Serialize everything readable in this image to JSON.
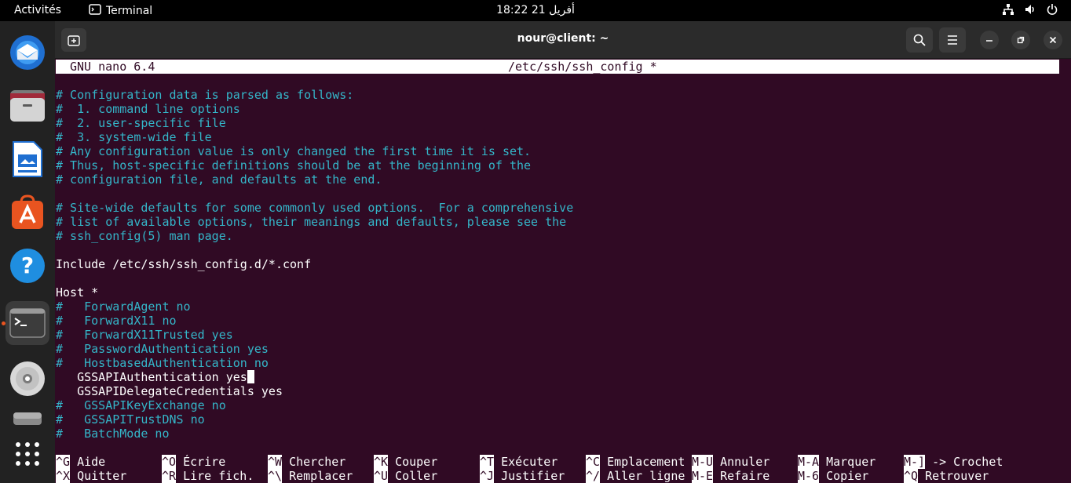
{
  "topbar": {
    "activities": "Activités",
    "app_name": "Terminal",
    "clock": "18:22  21 أفريل"
  },
  "dock": {
    "items": [
      "thunderbird-icon",
      "files-icon",
      "libreoffice-writer-icon",
      "app-center-icon",
      "help-icon",
      "terminal-icon",
      "disc-icon",
      "drive-icon",
      "app-grid-icon"
    ]
  },
  "window": {
    "title": "nour@client: ~"
  },
  "nano": {
    "version": "GNU nano 6.4",
    "filename": "/etc/ssh/ssh_config *",
    "lines": [
      {
        "text": "# Configuration data is parsed as follows:",
        "type": "comment"
      },
      {
        "text": "#  1. command line options",
        "type": "comment"
      },
      {
        "text": "#  2. user-specific file",
        "type": "comment"
      },
      {
        "text": "#  3. system-wide file",
        "type": "comment"
      },
      {
        "text": "# Any configuration value is only changed the first time it is set.",
        "type": "comment"
      },
      {
        "text": "# Thus, host-specific definitions should be at the beginning of the",
        "type": "comment"
      },
      {
        "text": "# configuration file, and defaults at the end.",
        "type": "comment"
      },
      {
        "text": "",
        "type": "plain"
      },
      {
        "text": "# Site-wide defaults for some commonly used options.  For a comprehensive",
        "type": "comment"
      },
      {
        "text": "# list of available options, their meanings and defaults, please see the",
        "type": "comment"
      },
      {
        "text": "# ssh_config(5) man page.",
        "type": "comment"
      },
      {
        "text": "",
        "type": "plain"
      },
      {
        "text": "Include /etc/ssh/ssh_config.d/*.conf",
        "type": "plain"
      },
      {
        "text": "",
        "type": "plain"
      },
      {
        "text": "Host *",
        "type": "plain"
      },
      {
        "text": "#   ForwardAgent no",
        "type": "comment"
      },
      {
        "text": "#   ForwardX11 no",
        "type": "comment"
      },
      {
        "text": "#   ForwardX11Trusted yes",
        "type": "comment"
      },
      {
        "text": "#   PasswordAuthentication yes",
        "type": "comment"
      },
      {
        "text": "#   HostbasedAuthentication no",
        "type": "comment"
      },
      {
        "text": "   GSSAPIAuthentication yes",
        "type": "plain"
      },
      {
        "text": "   GSSAPIDelegateCredentials yes",
        "type": "plain"
      },
      {
        "text": "#   GSSAPIKeyExchange no",
        "type": "comment"
      },
      {
        "text": "#   GSSAPITrustDNS no",
        "type": "comment"
      },
      {
        "text": "#   BatchMode no",
        "type": "comment"
      }
    ],
    "shortcuts_row1": [
      {
        "key": "^G",
        "label": "Aide"
      },
      {
        "key": "^O",
        "label": "Écrire"
      },
      {
        "key": "^W",
        "label": "Chercher"
      },
      {
        "key": "^K",
        "label": "Couper"
      },
      {
        "key": "^T",
        "label": "Exécuter"
      },
      {
        "key": "^C",
        "label": "Emplacement"
      },
      {
        "key": "M-U",
        "label": "Annuler"
      },
      {
        "key": "M-A",
        "label": "Marquer"
      },
      {
        "key": "M-]",
        "label": "-> Crochet"
      }
    ],
    "shortcuts_row2": [
      {
        "key": "^X",
        "label": "Quitter"
      },
      {
        "key": "^R",
        "label": "Lire fich."
      },
      {
        "key": "^\\",
        "label": "Remplacer"
      },
      {
        "key": "^U",
        "label": "Coller"
      },
      {
        "key": "^J",
        "label": "Justifier"
      },
      {
        "key": "^/",
        "label": "Aller ligne"
      },
      {
        "key": "M-E",
        "label": "Refaire"
      },
      {
        "key": "M-6",
        "label": "Copier"
      },
      {
        "key": "^Q",
        "label": "Retrouver"
      }
    ]
  }
}
